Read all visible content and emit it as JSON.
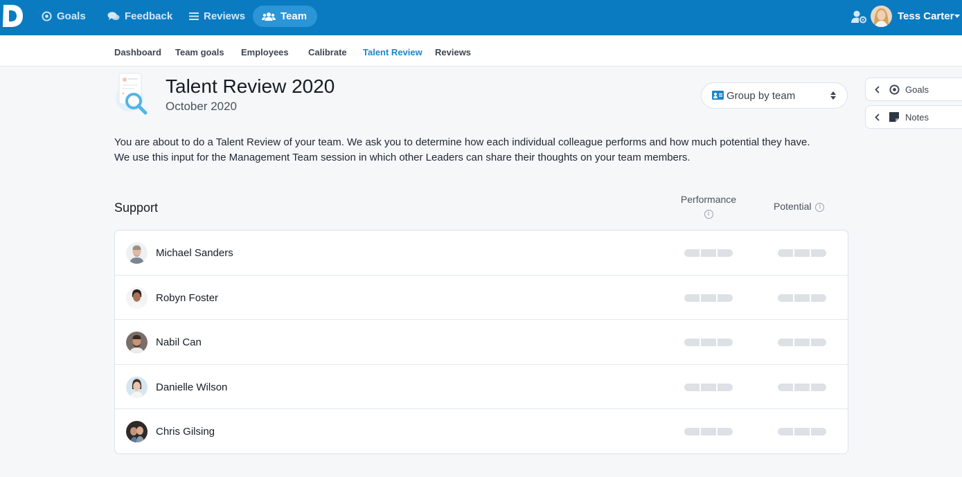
{
  "topnav": {
    "items": [
      {
        "label": "Goals",
        "icon": "target-icon"
      },
      {
        "label": "Feedback",
        "icon": "chat-bubbles-icon"
      },
      {
        "label": "Reviews",
        "icon": "list-icon"
      },
      {
        "label": "Team",
        "icon": "users-icon",
        "active": true
      }
    ],
    "user": {
      "name": "Tess Carter"
    }
  },
  "subnav": {
    "items": [
      "Dashboard",
      "Team goals",
      "Employees",
      "Calibrate",
      "Talent Review",
      "Reviews"
    ],
    "active": "Talent Review"
  },
  "header": {
    "title": "Talent Review 2020",
    "subtitle": "October 2020"
  },
  "group_select": {
    "value": "Group by team"
  },
  "side_panel": {
    "goals_label": "Goals",
    "notes_label": "Notes"
  },
  "intro": {
    "line1": "You are about to do a Talent Review of your team. We ask you to determine how each individual colleague performs and how much potential they have.",
    "line2": "We use this input for the Management Team session in which other Leaders can share their thoughts on your team members."
  },
  "section": {
    "title": "Support",
    "columns": {
      "performance": "Performance",
      "potential": "Potential"
    },
    "members": [
      {
        "name": "Michael Sanders"
      },
      {
        "name": "Robyn Foster"
      },
      {
        "name": "Nabil Can"
      },
      {
        "name": "Danielle Wilson"
      },
      {
        "name": "Chris Gilsing"
      }
    ]
  },
  "colors": {
    "brand": "#0a7bc1",
    "active_tab": "#1b86c8",
    "skeleton": "#dde1e6"
  }
}
